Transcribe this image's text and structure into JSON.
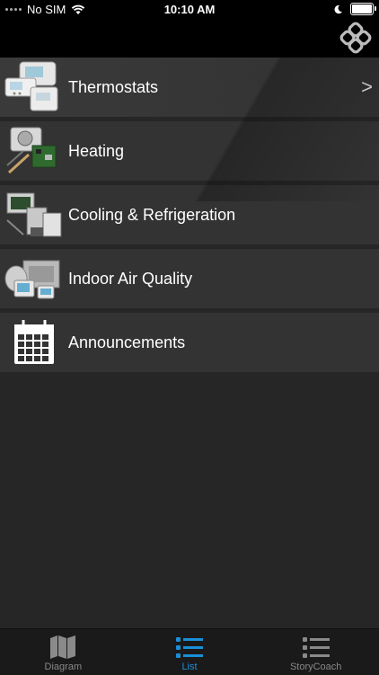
{
  "status_bar": {
    "carrier": "No SIM",
    "time": "10:10 AM"
  },
  "menu": {
    "items": [
      {
        "label": "Thermostats",
        "icon": "thermostat-thumbnail",
        "chevron": ">"
      },
      {
        "label": "Heating",
        "icon": "heating-thumbnail"
      },
      {
        "label": "Cooling & Refrigeration",
        "icon": "cooling-thumbnail"
      },
      {
        "label": "Indoor Air Quality",
        "icon": "air-quality-thumbnail"
      },
      {
        "label": "Announcements",
        "icon": "calendar-icon"
      }
    ]
  },
  "tabbar": {
    "tabs": [
      {
        "label": "Diagram",
        "icon": "map-icon"
      },
      {
        "label": "List",
        "icon": "list-icon",
        "active": true
      },
      {
        "label": "StoryCoach",
        "icon": "list-icon"
      }
    ]
  },
  "colors": {
    "accent": "#1a8fd8",
    "row_bg": "#333333",
    "page_bg": "#262626"
  }
}
